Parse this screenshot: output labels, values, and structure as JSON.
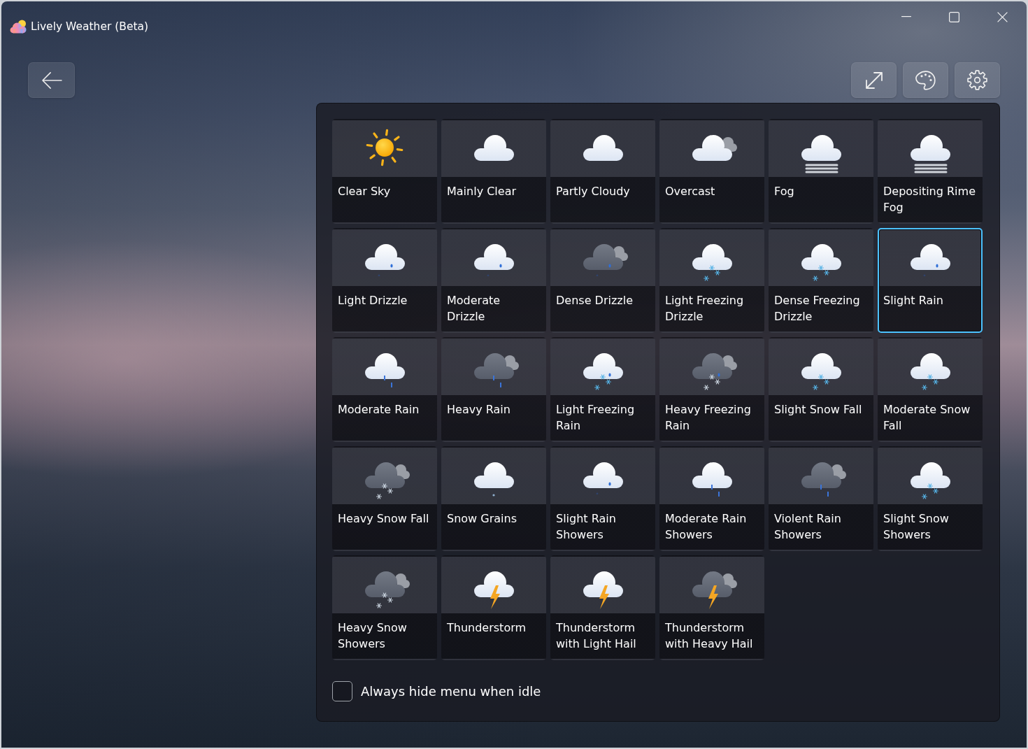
{
  "window": {
    "title": "Lively Weather (Beta)"
  },
  "tiles": [
    {
      "label": "Clear Sky",
      "kind": "sun",
      "selected": false
    },
    {
      "label": "Mainly Clear",
      "kind": "cloud",
      "selected": false
    },
    {
      "label": "Partly Cloudy",
      "kind": "cloud",
      "selected": false
    },
    {
      "label": "Overcast",
      "kind": "overcast",
      "selected": false
    },
    {
      "label": "Fog",
      "kind": "fog",
      "selected": false
    },
    {
      "label": "Depositing Rime Fog",
      "kind": "fog",
      "selected": false
    },
    {
      "label": "Light Drizzle",
      "kind": "drizzle",
      "selected": false
    },
    {
      "label": "Moderate Drizzle",
      "kind": "drizzle",
      "selected": false
    },
    {
      "label": "Dense Drizzle",
      "kind": "darkdrizzle",
      "selected": false
    },
    {
      "label": "Light Freezing Drizzle",
      "kind": "flakes",
      "selected": false
    },
    {
      "label": "Dense Freezing Drizzle",
      "kind": "flakes",
      "selected": false
    },
    {
      "label": "Slight Rain",
      "kind": "drizzle",
      "selected": true
    },
    {
      "label": "Moderate Rain",
      "kind": "rain",
      "selected": false
    },
    {
      "label": "Heavy Rain",
      "kind": "darkrain",
      "selected": false
    },
    {
      "label": "Light Freezing Rain",
      "kind": "sleet",
      "selected": false
    },
    {
      "label": "Heavy Freezing Rain",
      "kind": "darksleet",
      "selected": false
    },
    {
      "label": "Slight Snow Fall",
      "kind": "flakes",
      "selected": false
    },
    {
      "label": "Moderate Snow Fall",
      "kind": "flakes",
      "selected": false
    },
    {
      "label": "Heavy Snow Fall",
      "kind": "darkflakes",
      "selected": false
    },
    {
      "label": "Snow Grains",
      "kind": "grains",
      "selected": false
    },
    {
      "label": "Slight Rain Showers",
      "kind": "drizzle",
      "selected": false
    },
    {
      "label": "Moderate Rain Showers",
      "kind": "rain",
      "selected": false
    },
    {
      "label": "Violent Rain Showers",
      "kind": "darkrain",
      "selected": false
    },
    {
      "label": "Slight Snow Showers",
      "kind": "flakes",
      "selected": false
    },
    {
      "label": "Heavy Snow Showers",
      "kind": "darkflakes",
      "selected": false
    },
    {
      "label": "Thunderstorm",
      "kind": "storm",
      "selected": false
    },
    {
      "label": "Thunderstorm with Light Hail",
      "kind": "storm",
      "selected": false
    },
    {
      "label": "Thunderstorm with Heavy Hail",
      "kind": "darkstorm",
      "selected": false
    }
  ],
  "always_hide_menu": {
    "label": "Always hide menu when idle",
    "checked": false
  }
}
